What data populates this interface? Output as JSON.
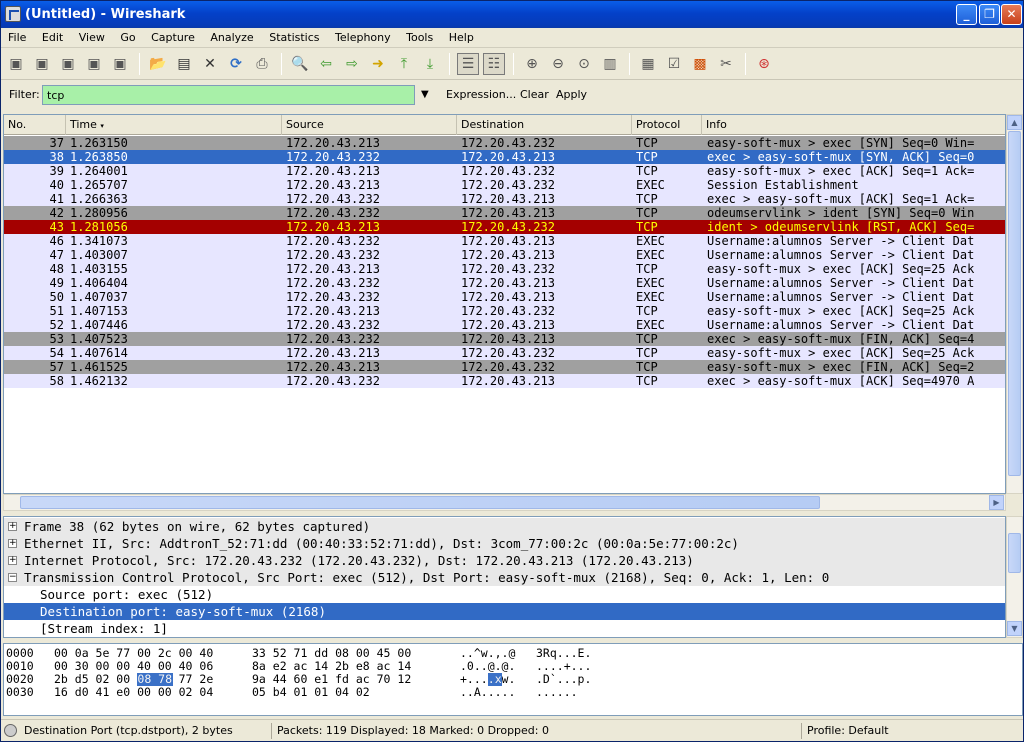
{
  "window": {
    "title": "(Untitled) - Wireshark"
  },
  "menu": [
    "File",
    "Edit",
    "View",
    "Go",
    "Capture",
    "Analyze",
    "Statistics",
    "Telephony",
    "Tools",
    "Help"
  ],
  "filter": {
    "label": "Filter:",
    "value": "tcp",
    "expression": "Expression...",
    "clear": "Clear",
    "apply": "Apply"
  },
  "columns": [
    "No.",
    "Time",
    "Source",
    "Destination",
    "Protocol",
    "Info"
  ],
  "packets": [
    {
      "no": "37",
      "time": "1.263150",
      "src": "172.20.43.213",
      "dst": "172.20.43.232",
      "proto": "TCP",
      "info": "easy-soft-mux > exec [SYN] Seq=0 Win=",
      "bg": "#a0a0a0",
      "fg": "#000000"
    },
    {
      "no": "38",
      "time": "1.263850",
      "src": "172.20.43.232",
      "dst": "172.20.43.213",
      "proto": "TCP",
      "info": "exec > easy-soft-mux [SYN, ACK] Seq=0",
      "bg": "#316ac5",
      "fg": "#ffffff"
    },
    {
      "no": "39",
      "time": "1.264001",
      "src": "172.20.43.213",
      "dst": "172.20.43.232",
      "proto": "TCP",
      "info": "easy-soft-mux > exec [ACK] Seq=1 Ack=",
      "bg": "#e7e6ff",
      "fg": "#000000"
    },
    {
      "no": "40",
      "time": "1.265707",
      "src": "172.20.43.213",
      "dst": "172.20.43.232",
      "proto": "EXEC",
      "info": "Session Establishment",
      "bg": "#e7e6ff",
      "fg": "#000000"
    },
    {
      "no": "41",
      "time": "1.266363",
      "src": "172.20.43.232",
      "dst": "172.20.43.213",
      "proto": "TCP",
      "info": "exec > easy-soft-mux [ACK] Seq=1 Ack=",
      "bg": "#e7e6ff",
      "fg": "#000000"
    },
    {
      "no": "42",
      "time": "1.280956",
      "src": "172.20.43.232",
      "dst": "172.20.43.213",
      "proto": "TCP",
      "info": "odeumservlink > ident [SYN] Seq=0 Win",
      "bg": "#a0a0a0",
      "fg": "#000000"
    },
    {
      "no": "43",
      "time": "1.281056",
      "src": "172.20.43.213",
      "dst": "172.20.43.232",
      "proto": "TCP",
      "info": "ident > odeumservlink [RST, ACK] Seq=",
      "bg": "#a40000",
      "fg": "#ffff00"
    },
    {
      "no": "46",
      "time": "1.341073",
      "src": "172.20.43.232",
      "dst": "172.20.43.213",
      "proto": "EXEC",
      "info": "Username:alumnos Server -> Client Dat",
      "bg": "#e7e6ff",
      "fg": "#000000"
    },
    {
      "no": "47",
      "time": "1.403007",
      "src": "172.20.43.232",
      "dst": "172.20.43.213",
      "proto": "EXEC",
      "info": "Username:alumnos Server -> Client Dat",
      "bg": "#e7e6ff",
      "fg": "#000000"
    },
    {
      "no": "48",
      "time": "1.403155",
      "src": "172.20.43.213",
      "dst": "172.20.43.232",
      "proto": "TCP",
      "info": "easy-soft-mux > exec [ACK] Seq=25 Ack",
      "bg": "#e7e6ff",
      "fg": "#000000"
    },
    {
      "no": "49",
      "time": "1.406404",
      "src": "172.20.43.232",
      "dst": "172.20.43.213",
      "proto": "EXEC",
      "info": "Username:alumnos Server -> Client Dat",
      "bg": "#e7e6ff",
      "fg": "#000000"
    },
    {
      "no": "50",
      "time": "1.407037",
      "src": "172.20.43.232",
      "dst": "172.20.43.213",
      "proto": "EXEC",
      "info": "Username:alumnos Server -> Client Dat",
      "bg": "#e7e6ff",
      "fg": "#000000"
    },
    {
      "no": "51",
      "time": "1.407153",
      "src": "172.20.43.213",
      "dst": "172.20.43.232",
      "proto": "TCP",
      "info": "easy-soft-mux > exec [ACK] Seq=25 Ack",
      "bg": "#e7e6ff",
      "fg": "#000000"
    },
    {
      "no": "52",
      "time": "1.407446",
      "src": "172.20.43.232",
      "dst": "172.20.43.213",
      "proto": "EXEC",
      "info": "Username:alumnos Server -> Client Dat",
      "bg": "#e7e6ff",
      "fg": "#000000"
    },
    {
      "no": "53",
      "time": "1.407523",
      "src": "172.20.43.232",
      "dst": "172.20.43.213",
      "proto": "TCP",
      "info": "exec > easy-soft-mux [FIN, ACK] Seq=4",
      "bg": "#a0a0a0",
      "fg": "#000000"
    },
    {
      "no": "54",
      "time": "1.407614",
      "src": "172.20.43.213",
      "dst": "172.20.43.232",
      "proto": "TCP",
      "info": "easy-soft-mux > exec [ACK] Seq=25 Ack",
      "bg": "#e7e6ff",
      "fg": "#000000"
    },
    {
      "no": "57",
      "time": "1.461525",
      "src": "172.20.43.213",
      "dst": "172.20.43.232",
      "proto": "TCP",
      "info": "easy-soft-mux > exec [FIN, ACK] Seq=2",
      "bg": "#a0a0a0",
      "fg": "#000000"
    },
    {
      "no": "58",
      "time": "1.462132",
      "src": "172.20.43.232",
      "dst": "172.20.43.213",
      "proto": "TCP",
      "info": "exec > easy-soft-mux [ACK] Seq=4970 A",
      "bg": "#e7e6ff",
      "fg": "#000000"
    }
  ],
  "details": [
    {
      "text": "Frame 38 (62 bytes on wire, 62 bytes captured)",
      "expander": "+",
      "selected": false,
      "shaded": true
    },
    {
      "text": "Ethernet II, Src: AddtronT_52:71:dd (00:40:33:52:71:dd), Dst: 3com_77:00:2c (00:0a:5e:77:00:2c)",
      "expander": "+",
      "selected": false,
      "shaded": true
    },
    {
      "text": "Internet Protocol, Src: 172.20.43.232 (172.20.43.232), Dst: 172.20.43.213 (172.20.43.213)",
      "expander": "+",
      "selected": false,
      "shaded": true
    },
    {
      "text": "Transmission Control Protocol, Src Port: exec (512), Dst Port: easy-soft-mux (2168), Seq: 0, Ack: 1, Len: 0",
      "expander": "−",
      "selected": false,
      "shaded": true
    },
    {
      "text": "Source port: exec (512)",
      "expander": "",
      "selected": false,
      "shaded": false
    },
    {
      "text": "Destination port: easy-soft-mux (2168)",
      "expander": "",
      "selected": true,
      "shaded": false
    },
    {
      "text": "[Stream index: 1]",
      "expander": "",
      "selected": false,
      "shaded": false
    }
  ],
  "bytes": [
    {
      "offset": "0000",
      "hex_a": "00 0a 5e 77 00 2c 00 40",
      "hex_b": "33 52 71 dd 08 00 45 00",
      "ascii_a": "..^w.,.@",
      "ascii_b": "3Rq...E."
    },
    {
      "offset": "0010",
      "hex_a": "00 30 00 00 40 00 40 06",
      "hex_b": "8a e2 ac 14 2b e8 ac 14",
      "ascii_a": ".0..@.@.",
      "ascii_b": "....+..."
    },
    {
      "offset": "0020",
      "hex_a": "2b d5 02 00 08 78 77 2e",
      "hex_b": "9a 44 60 e1 fd ac 70 12",
      "ascii_a": "+....xw.",
      "ascii_b": ".D`...p."
    },
    {
      "offset": "0030",
      "hex_a": "16 d0 41 e0 00 00 02 04",
      "hex_b": "05 b4 01 01 04 02",
      "ascii_a": "..A.....",
      "ascii_b": "......"
    }
  ],
  "status": {
    "field": "Destination Port (tcp.dstport), 2 bytes",
    "packets": "Packets: 119 Displayed: 18 Marked: 0 Dropped: 0",
    "profile": "Profile: Default"
  }
}
